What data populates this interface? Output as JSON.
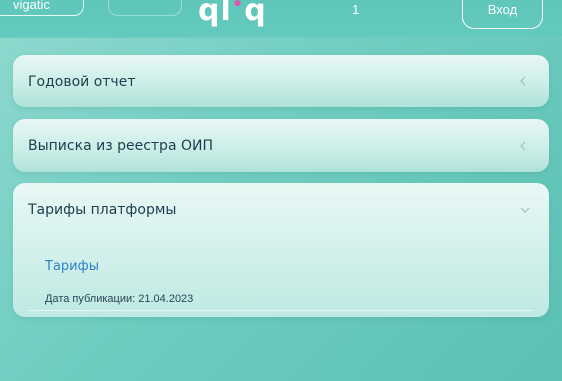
{
  "header": {
    "nav_button_1_label": "vigatic",
    "nav_button_2_label": "",
    "logo_text": "qliq",
    "page_number": "1",
    "login_label": "Вход"
  },
  "accordion": [
    {
      "title": "Годовой отчет",
      "expanded": false
    },
    {
      "title": "Выписка из реестра ОИП",
      "expanded": false
    },
    {
      "title": "Тарифы платформы",
      "expanded": true,
      "link_label": "Тарифы",
      "publication_date": "Дата публикации: 21.04.2023"
    }
  ],
  "colors": {
    "accent": "#5fc7b9",
    "link": "#2d82c9",
    "title_text": "#1f3c4e"
  }
}
